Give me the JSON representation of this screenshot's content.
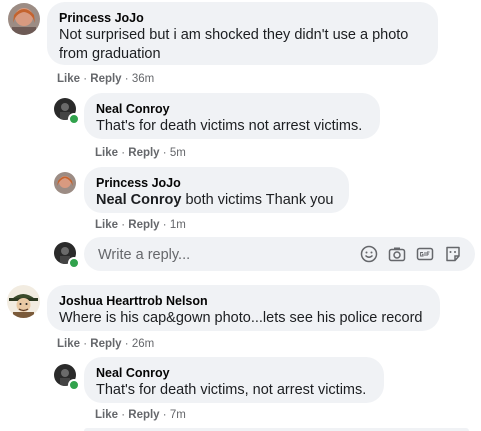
{
  "comments": [
    {
      "author": "Princess JoJo",
      "text_line1": "Not surprised but i am shocked they didn't use a photo",
      "text_line2": "from graduation",
      "like": "Like",
      "reply": "Reply",
      "time": "36m",
      "replies": [
        {
          "author": "Neal Conroy",
          "text": "That's for death victims not arrest victims.",
          "like": "Like",
          "reply": "Reply",
          "time": "5m"
        },
        {
          "author": "Princess JoJo",
          "mention": "Neal Conroy",
          "text": " both victims Thank you",
          "like": "Like",
          "reply": "Reply",
          "time": "1m"
        }
      ]
    },
    {
      "author": "Joshua Hearttrob Nelson",
      "text": "Where is his cap&gown photo...lets see his police record",
      "like": "Like",
      "reply": "Reply",
      "time": "26m",
      "replies": [
        {
          "author": "Neal Conroy",
          "text": "That's for death victims, not arrest victims.",
          "like": "Like",
          "reply": "Reply",
          "time": "7m"
        }
      ]
    }
  ],
  "reply_box": {
    "placeholder": "Write a reply...",
    "icons": [
      "emoji-icon",
      "camera-icon",
      "gif-icon",
      "sticker-icon"
    ]
  },
  "colors": {
    "bubble": "#f0f2f5",
    "meta_text": "#65676b",
    "online": "#31a24c"
  }
}
